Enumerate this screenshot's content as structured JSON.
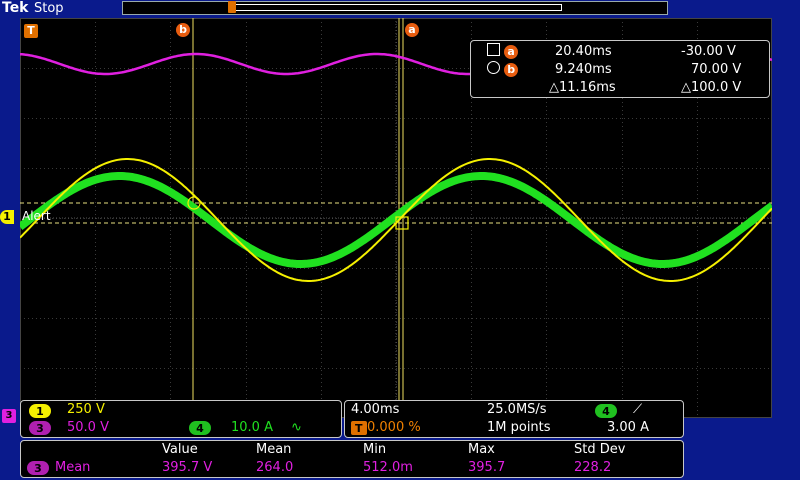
{
  "header": {
    "brand": "Tek",
    "status": "Stop"
  },
  "markers": {
    "trigger": "T",
    "cursor_a": "a",
    "cursor_b": "b",
    "ch1": "1",
    "ch3_offscreen": "3",
    "alert": "Alert"
  },
  "cursor_readout": {
    "a": {
      "label": "a",
      "time": "20.40ms",
      "value": "-30.00 V"
    },
    "b": {
      "label": "b",
      "time": "9.240ms",
      "value": "70.00 V"
    },
    "delta": {
      "time": "△11.16ms",
      "value": "△100.0 V"
    }
  },
  "channels_panel": {
    "ch1": {
      "num": "1",
      "scale": "250 V"
    },
    "ch3": {
      "num": "3",
      "scale": "50.0 V"
    },
    "ch4": {
      "num": "4",
      "scale": "10.0 A",
      "coupling": "∿"
    }
  },
  "timebase_panel": {
    "horizontal_scale": "4.00ms",
    "sample_rate": "25.0MS/s",
    "trigger_source": "4",
    "trigger_slope": "⟋",
    "trigger_label": "T",
    "trigger_position": "0.000 %",
    "record_length": "1M points",
    "trigger_level": "3.00 A"
  },
  "measurement_panel": {
    "headers": [
      "Value",
      "Mean",
      "Min",
      "Max",
      "Std Dev"
    ],
    "row": {
      "source": "3",
      "name": "Mean",
      "values": [
        "395.7 V",
        "264.0",
        "512.0m",
        "395.7",
        "228.2"
      ]
    }
  },
  "colors": {
    "ch1": "#f5f000",
    "ch3": "#e020e0",
    "ch4": "#20e020",
    "cursor": "#e85d10",
    "background": "#0a1a8c"
  }
}
